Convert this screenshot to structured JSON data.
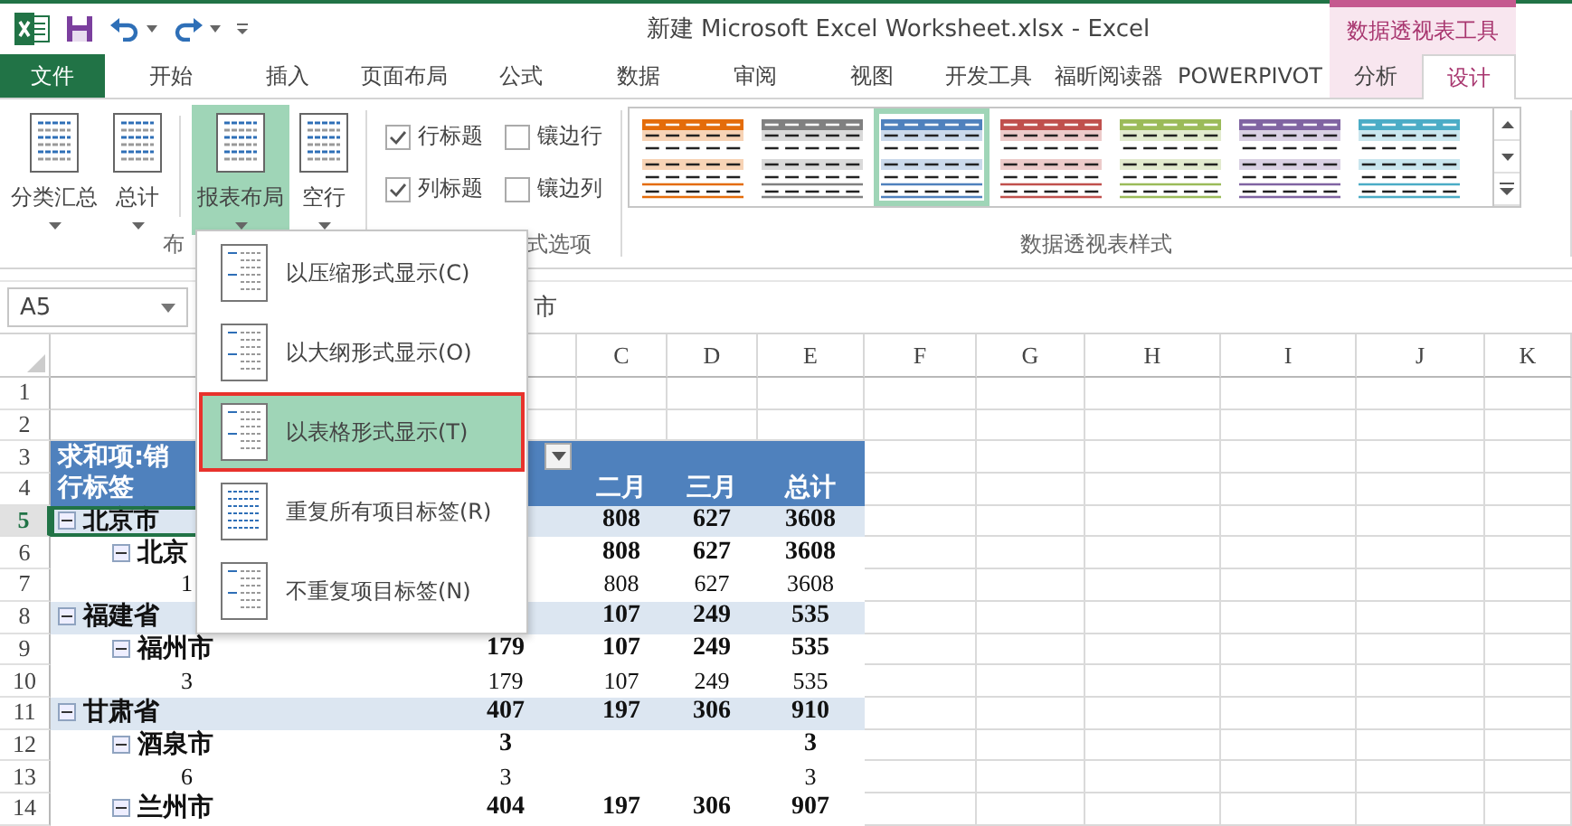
{
  "title_bar": {
    "title": "新建 Microsoft Excel Worksheet.xlsx - Excel",
    "context_group": "数据透视表工具"
  },
  "tabs": [
    {
      "label": "文件",
      "kind": "file",
      "selected": false
    },
    {
      "label": "开始",
      "kind": "normal",
      "selected": false
    },
    {
      "label": "插入",
      "kind": "normal",
      "selected": false
    },
    {
      "label": "页面布局",
      "kind": "normal",
      "selected": false
    },
    {
      "label": "公式",
      "kind": "normal",
      "selected": false
    },
    {
      "label": "数据",
      "kind": "normal",
      "selected": false
    },
    {
      "label": "审阅",
      "kind": "normal",
      "selected": false
    },
    {
      "label": "视图",
      "kind": "normal",
      "selected": false
    },
    {
      "label": "开发工具",
      "kind": "normal",
      "selected": false
    },
    {
      "label": "福昕阅读器",
      "kind": "normal",
      "selected": false
    },
    {
      "label": "POWERPIVOT",
      "kind": "normal",
      "selected": false
    },
    {
      "label": "分析",
      "kind": "context",
      "selected": false
    },
    {
      "label": "设计",
      "kind": "context",
      "selected": true
    }
  ],
  "ribbon": {
    "layout_buttons": [
      {
        "label": "分类汇总",
        "active": false
      },
      {
        "label": "总计",
        "active": false
      },
      {
        "label": "报表布局",
        "active": true
      },
      {
        "label": "空行",
        "active": false
      }
    ],
    "layout_group_label": "布",
    "options": [
      {
        "label": "行标题",
        "checked": true
      },
      {
        "label": "镶边行",
        "checked": false
      },
      {
        "label": "列标题",
        "checked": true
      },
      {
        "label": "镶边列",
        "checked": false
      }
    ],
    "options_group_label": "式选项",
    "styles": [
      {
        "color": "#e46c0a",
        "selected": false
      },
      {
        "color": "#808080",
        "selected": false
      },
      {
        "color": "#4f81bd",
        "selected": true
      },
      {
        "color": "#c0504d",
        "selected": false
      },
      {
        "color": "#9bbb59",
        "selected": false
      },
      {
        "color": "#8064a2",
        "selected": false
      },
      {
        "color": "#4bacc6",
        "selected": false
      }
    ],
    "styles_group_label": "数据透视表样式"
  },
  "formula_bar": {
    "name_box": "A5",
    "formula": "市"
  },
  "columns": [
    "C",
    "D",
    "E",
    "F",
    "G",
    "H",
    "I",
    "J",
    "K"
  ],
  "rows": [
    {
      "number": "1",
      "kind": "blank",
      "selected": false
    },
    {
      "number": "2",
      "kind": "blank",
      "selected": false
    },
    {
      "number": "3",
      "kind": "title",
      "selected": false,
      "label": "求和项:销",
      "filter": true
    },
    {
      "number": "4",
      "kind": "header",
      "selected": false,
      "label": "行标签",
      "col_c": "二月",
      "col_d": "三月",
      "col_e": "总计"
    },
    {
      "number": "5",
      "kind": "region",
      "selected": true,
      "expanded": true,
      "label": "北京市",
      "col_c": "808",
      "col_d": "627",
      "col_e": "3608"
    },
    {
      "number": "6",
      "kind": "city",
      "selected": false,
      "expanded": true,
      "label": "北京",
      "col_c": "808",
      "col_d": "627",
      "col_e": "3608"
    },
    {
      "number": "7",
      "kind": "detail",
      "selected": false,
      "label": "1",
      "col_c": "808",
      "col_d": "627",
      "col_e": "3608"
    },
    {
      "number": "8",
      "kind": "region",
      "selected": false,
      "expanded": true,
      "label": "福建省",
      "col_c": "107",
      "col_d": "249",
      "col_e": "535"
    },
    {
      "number": "9",
      "kind": "city",
      "selected": false,
      "expanded": true,
      "label": "福州市",
      "col_b": "179",
      "col_c": "107",
      "col_d": "249",
      "col_e": "535"
    },
    {
      "number": "10",
      "kind": "detail",
      "selected": false,
      "label": "3",
      "col_b": "179",
      "col_c": "107",
      "col_d": "249",
      "col_e": "535"
    },
    {
      "number": "11",
      "kind": "region",
      "selected": false,
      "expanded": true,
      "label": "甘肃省",
      "col_b": "407",
      "col_c": "197",
      "col_d": "306",
      "col_e": "910"
    },
    {
      "number": "12",
      "kind": "city",
      "selected": false,
      "expanded": true,
      "label": "酒泉市",
      "col_b": "3",
      "col_e": "3"
    },
    {
      "number": "13",
      "kind": "detail",
      "selected": false,
      "label": "6",
      "col_b": "3",
      "col_e": "3"
    },
    {
      "number": "14",
      "kind": "city",
      "selected": false,
      "expanded": true,
      "label": "兰州市",
      "col_b": "404",
      "col_c": "197",
      "col_d": "306",
      "col_e": "907"
    }
  ],
  "layout_menu": {
    "items": [
      {
        "label": "以压缩形式显示(C)",
        "selected": false
      },
      {
        "label": "以大纲形式显示(O)",
        "selected": false
      },
      {
        "label": "以表格形式显示(T)",
        "selected": true
      },
      {
        "label": "重复所有项目标签(R)",
        "selected": false
      },
      {
        "label": "不重复项目标签(N)",
        "selected": false
      }
    ]
  }
}
